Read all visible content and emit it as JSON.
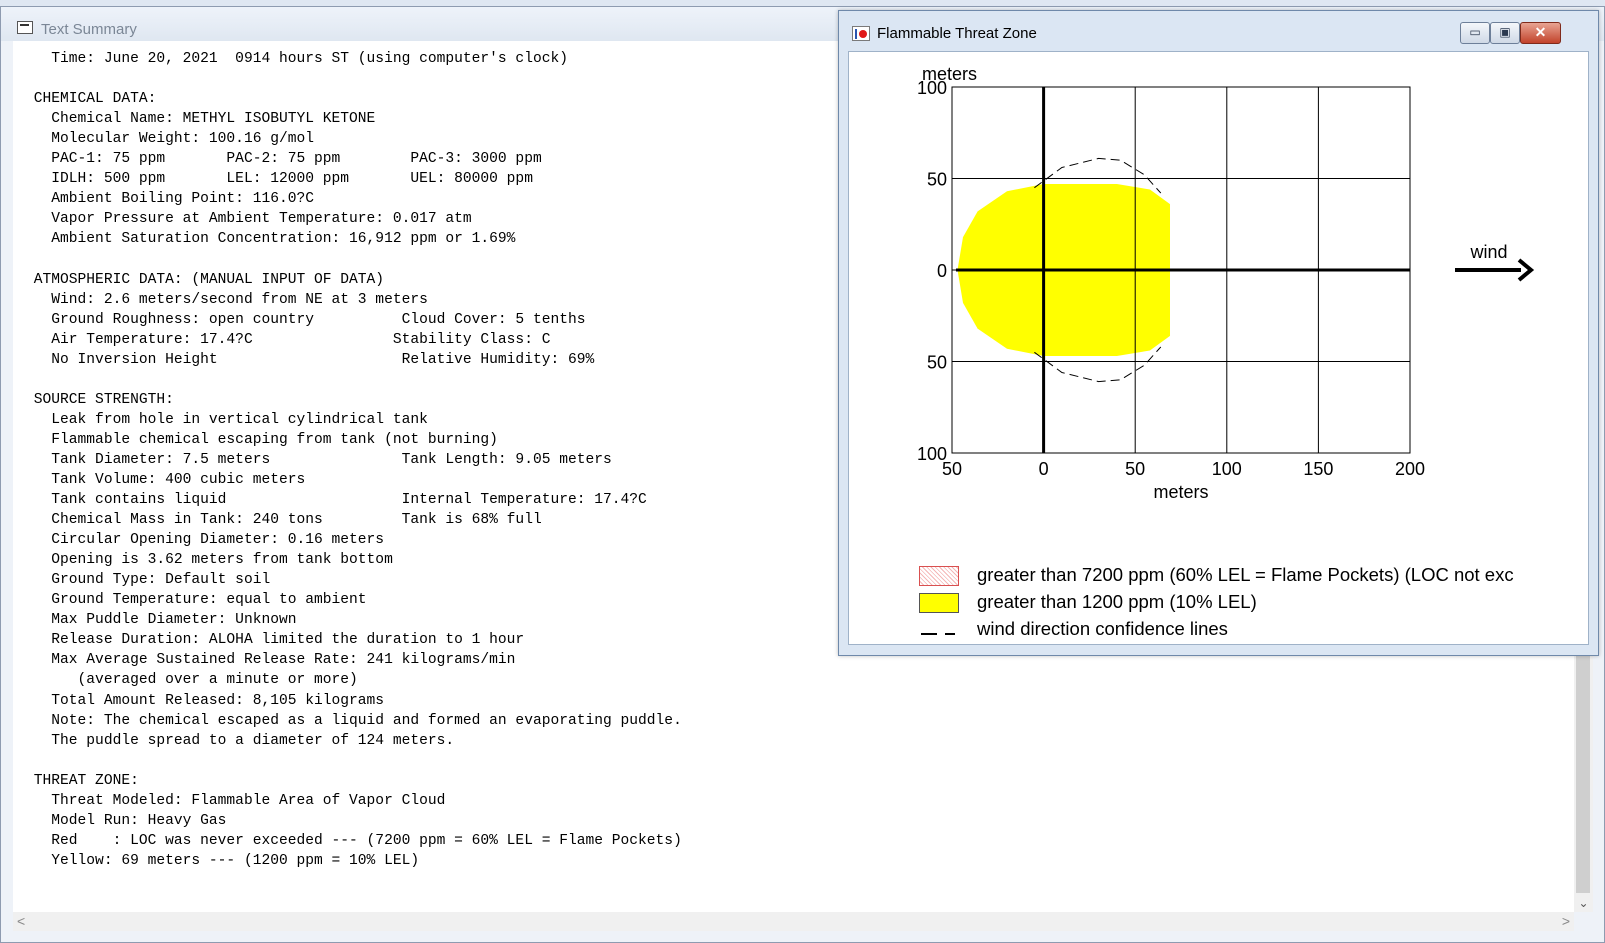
{
  "text_summary": {
    "title": "Text Summary",
    "lines": [
      "   Time: June 20, 2021  0914 hours ST (using computer's clock)",
      "",
      " CHEMICAL DATA:",
      "   Chemical Name: METHYL ISOBUTYL KETONE",
      "   Molecular Weight: 100.16 g/mol",
      "   PAC-1: 75 ppm       PAC-2: 75 ppm        PAC-3: 3000 ppm",
      "   IDLH: 500 ppm       LEL: 12000 ppm       UEL: 80000 ppm",
      "   Ambient Boiling Point: 116.0?C",
      "   Vapor Pressure at Ambient Temperature: 0.017 atm",
      "   Ambient Saturation Concentration: 16,912 ppm or 1.69%",
      "",
      " ATMOSPHERIC DATA: (MANUAL INPUT OF DATA)",
      "   Wind: 2.6 meters/second from NE at 3 meters",
      "   Ground Roughness: open country          Cloud Cover: 5 tenths",
      "   Air Temperature: 17.4?C                Stability Class: C",
      "   No Inversion Height                     Relative Humidity: 69%",
      "",
      " SOURCE STRENGTH:",
      "   Leak from hole in vertical cylindrical tank",
      "   Flammable chemical escaping from tank (not burning)",
      "   Tank Diameter: 7.5 meters               Tank Length: 9.05 meters",
      "   Tank Volume: 400 cubic meters",
      "   Tank contains liquid                    Internal Temperature: 17.4?C",
      "   Chemical Mass in Tank: 240 tons         Tank is 68% full",
      "   Circular Opening Diameter: 0.16 meters",
      "   Opening is 3.62 meters from tank bottom",
      "   Ground Type: Default soil",
      "   Ground Temperature: equal to ambient",
      "   Max Puddle Diameter: Unknown",
      "   Release Duration: ALOHA limited the duration to 1 hour",
      "   Max Average Sustained Release Rate: 241 kilograms/min",
      "      (averaged over a minute or more)",
      "   Total Amount Released: 8,105 kilograms",
      "   Note: The chemical escaped as a liquid and formed an evaporating puddle.",
      "   The puddle spread to a diameter of 124 meters.",
      "",
      " THREAT ZONE:",
      "   Threat Modeled: Flammable Area of Vapor Cloud",
      "   Model Run: Heavy Gas",
      "   Red    : LOC was never exceeded --- (7200 ppm = 60% LEL = Flame Pockets)",
      "   Yellow: 69 meters --- (1200 ppm = 10% LEL)"
    ],
    "scroll_down_glyph": "⌄",
    "scroll_left_glyph": "<",
    "scroll_right_glyph": ">"
  },
  "threat_window": {
    "title": "Flammable Threat Zone",
    "min_glyph": "▭",
    "max_glyph": "▣",
    "close_glyph": "✕",
    "plot": {
      "y_unit_label": "meters",
      "x_unit_label": "meters",
      "wind_label": "wind",
      "x_tick_labels": [
        "50",
        "0",
        "50",
        "100",
        "150",
        "200"
      ],
      "y_tick_labels": [
        "100",
        "50",
        "0",
        "50",
        "100"
      ]
    },
    "legend": [
      {
        "swatch": "red-dotted",
        "label": "greater than 7200 ppm (60% LEL = Flame Pockets) (LOC not exc"
      },
      {
        "swatch": "yellow",
        "label": "greater than 1200 ppm (10% LEL)"
      },
      {
        "swatch": "dash",
        "label": "wind direction confidence lines"
      }
    ]
  },
  "colors": {
    "threat_yellow": "#ffff00",
    "flame_pocket_red": "#d95050",
    "grid": "#000000"
  },
  "chart_data": {
    "type": "area",
    "x_range": [
      -50,
      200
    ],
    "y_range": [
      -100,
      100
    ],
    "x_ticks": [
      -50,
      0,
      50,
      100,
      150,
      200
    ],
    "y_ticks": [
      100,
      50,
      0,
      -50,
      -100
    ],
    "grid": true,
    "yellow_zone_outline": [
      [
        -47,
        0
      ],
      [
        -44,
        18
      ],
      [
        -36,
        32
      ],
      [
        -20,
        43
      ],
      [
        0,
        47
      ],
      [
        40,
        47
      ],
      [
        58,
        44
      ],
      [
        69,
        36
      ],
      [
        69,
        -36
      ],
      [
        58,
        -44
      ],
      [
        40,
        -47
      ],
      [
        0,
        -47
      ],
      [
        -20,
        -43
      ],
      [
        -36,
        -32
      ],
      [
        -44,
        -18
      ]
    ],
    "confidence_line_upper": [
      [
        -5,
        45
      ],
      [
        10,
        56
      ],
      [
        30,
        61
      ],
      [
        42,
        60
      ],
      [
        55,
        52
      ],
      [
        64,
        42
      ]
    ],
    "confidence_line_lower": [
      [
        -5,
        -45
      ],
      [
        10,
        -56
      ],
      [
        30,
        -61
      ],
      [
        42,
        -60
      ],
      [
        55,
        -52
      ],
      [
        64,
        -42
      ]
    ]
  }
}
